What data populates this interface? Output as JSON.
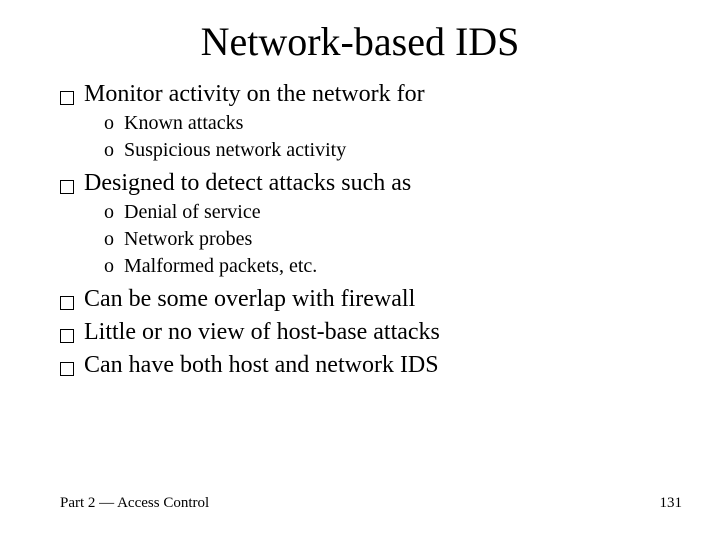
{
  "title": "Network-based IDS",
  "bullets": [
    {
      "text": "Monitor activity on the network for",
      "sub": [
        "Known attacks",
        "Suspicious network activity"
      ]
    },
    {
      "text": "Designed to detect attacks such as",
      "sub": [
        "Denial of service",
        "Network probes",
        "Malformed packets, etc."
      ]
    },
    {
      "text": "Can be some overlap with firewall",
      "sub": []
    },
    {
      "text": "Little or no view of host-base attacks",
      "sub": []
    },
    {
      "text": "Can have both host and network IDS",
      "sub": []
    }
  ],
  "footer_left": "Part 2 — Access Control",
  "footer_right": "131"
}
